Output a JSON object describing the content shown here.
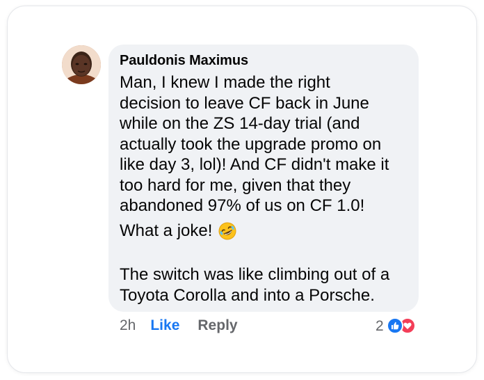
{
  "comment": {
    "author": "Pauldonis Maximus",
    "paragraph1_lines": [
      "Man, I knew I made the right",
      "decision to leave CF back in June",
      "while on the ZS 14-day trial (and",
      "actually took the upgrade promo on",
      "like day 3, lol)! And CF didn't make it",
      "too hard for me, given that they",
      "abandoned 97% of us on CF 1.0!"
    ],
    "paragraph2": "What a joke!",
    "paragraph2_emoji": "rolling-on-floor-laughing-emoji",
    "paragraph3_lines": [
      "The switch was like climbing out of a",
      "Toyota Corolla and into a Porsche."
    ]
  },
  "actions": {
    "timestamp": "2h",
    "like_label": "Like",
    "reply_label": "Reply"
  },
  "reactions": {
    "count": "2",
    "icons": [
      "like-reaction-icon",
      "love-reaction-icon"
    ]
  },
  "colors": {
    "bubble": "#f0f2f5",
    "like_blue": "#1877f2",
    "love_red": "#f33e58",
    "meta_gray": "#65676b"
  }
}
